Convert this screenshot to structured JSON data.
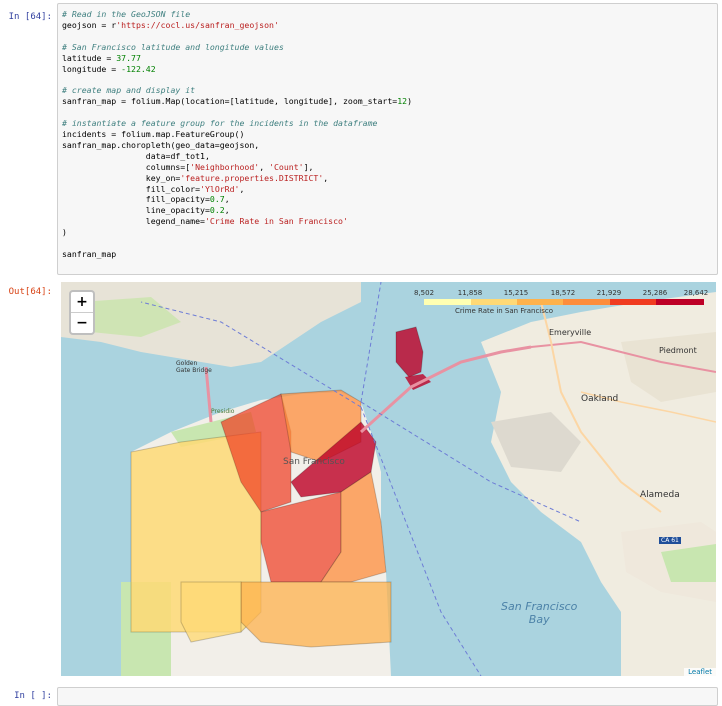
{
  "cells": {
    "in_prompt": "In [64]:",
    "out_prompt": "Out[64]:",
    "empty_prompt": "In [ ]:"
  },
  "code": {
    "c1": "# Read in the GeoJSON file",
    "l2a": "geojson = r",
    "l2s": "'https://cocl.us/sanfran_geojson'",
    "c3": "# San Francisco latitude and longitude values",
    "l4a": "latitude = ",
    "l4n": "37.77",
    "l5a": "longitude = ",
    "l5n": "-122.42",
    "c6": "# create map and display it",
    "l7a": "sanfran_map = folium.Map(location=[latitude, longitude], zoom_start=",
    "l7n": "12",
    "l7b": ")",
    "c8": "# instantiate a feature group for the incidents in the dataframe",
    "l9": "incidents = folium.map.FeatureGroup()",
    "l10": "sanfran_map.choropleth(geo_data=geojson,",
    "l11": "                 data=df_tot1,",
    "l12a": "                 columns=[",
    "l12s1": "'Neighborhood'",
    "l12b": ", ",
    "l12s2": "'Count'",
    "l12c": "],",
    "l13a": "                 key_on=",
    "l13s": "'feature.properties.DISTRICT'",
    "l13b": ",",
    "l14a": "                 fill_color=",
    "l14s": "'YlOrRd'",
    "l14b": ",",
    "l15a": "                 fill_opacity=",
    "l15n": "0.7",
    "l15b": ",",
    "l16a": "                 line_opacity=",
    "l16n": "0.2",
    "l16b": ",",
    "l17a": "                 legend_name=",
    "l17s": "'Crime Rate in San Francisco'",
    "l18": ")",
    "l19": "sanfran_map"
  },
  "map": {
    "zoom_in": "+",
    "zoom_out": "−",
    "legend_ticks": [
      "8,502",
      "11,858",
      "15,215",
      "18,572",
      "21,929",
      "25,286",
      "28,642"
    ],
    "legend_title": "Crime Rate in San Francisco",
    "legend_colors": [
      "#ffffb2",
      "#fed976",
      "#feb24c",
      "#fd8d3c",
      "#f03b20",
      "#bd0026"
    ],
    "attribution": "Leaflet",
    "labels": {
      "golden_gate": "Golden\nGate Bridge",
      "san_francisco": "San Francisco",
      "emeryville": "Emeryville",
      "piedmont": "Piedmont",
      "oakland": "Oakland",
      "alameda": "Alameda",
      "sf_bay": "San Francisco\nBay",
      "presidio": "Presidio",
      "ca61": "CA 61"
    }
  },
  "colors": {
    "water": "#aad3df",
    "land": "#f2efe9",
    "park": "#c8e6b0"
  }
}
